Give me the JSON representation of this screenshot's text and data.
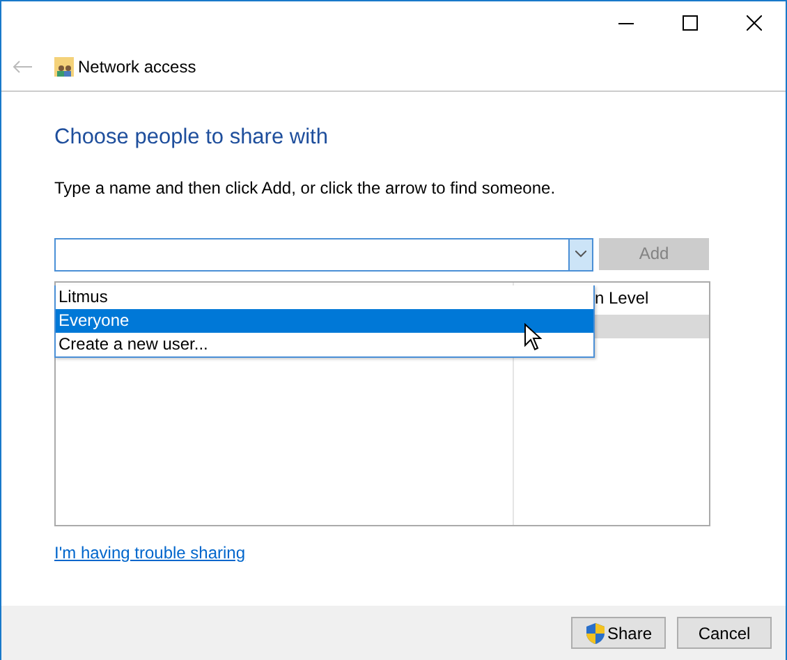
{
  "window": {
    "title": "Network access"
  },
  "heading": "Choose people to share with",
  "instruction": "Type a name and then click Add, or click the arrow to find someone.",
  "name_combo": {
    "expanded": true,
    "options": [
      {
        "label": "Litmus",
        "selected": false
      },
      {
        "label": "Everyone",
        "selected": true
      },
      {
        "label": "Create a new user...",
        "selected": false
      }
    ]
  },
  "add_button": {
    "label": "Add",
    "disabled": true
  },
  "table": {
    "columns": [
      "n Level"
    ],
    "rows": [
      {
        "selected": true
      }
    ]
  },
  "trouble_link": "I'm having trouble sharing",
  "buttons": [
    {
      "kind": "shield",
      "label": "Share"
    },
    {
      "kind": "plain",
      "label": "Cancel"
    }
  ]
}
